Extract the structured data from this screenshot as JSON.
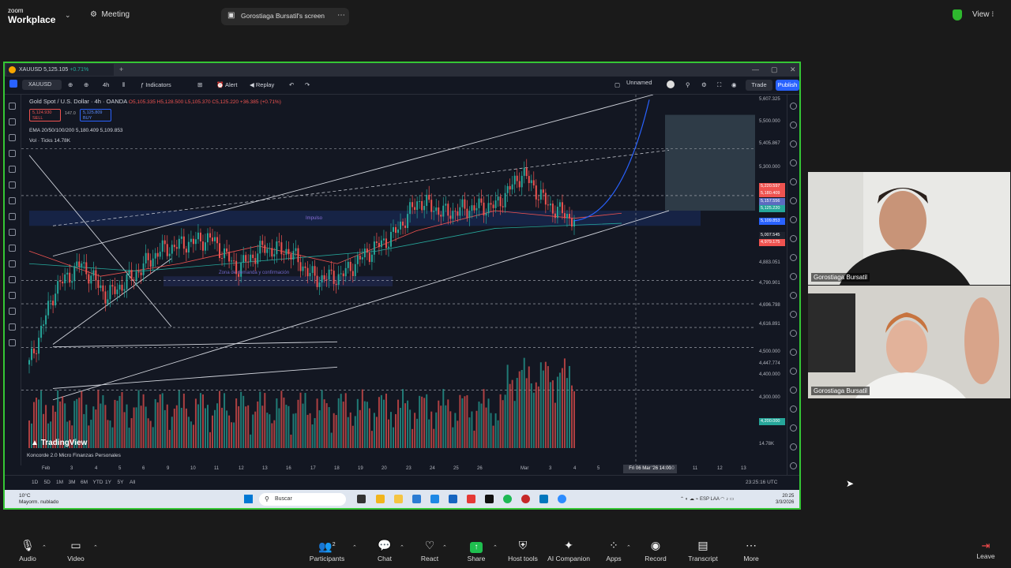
{
  "zoom_top": {
    "brand_small": "zoom",
    "brand": "Workplace",
    "meeting": "Meeting",
    "share_tab": "Gorostiaga Bursatil's screen",
    "view": "View"
  },
  "tradingview": {
    "tab_symbol": "XAUUSD",
    "tab_price": "5,125.105",
    "tab_change": "+0.71%",
    "symbol": "XAUUSD",
    "timeframe": "4h",
    "toolbar": {
      "indicators": "Indicators",
      "alert": "Alert",
      "replay": "Replay",
      "layout": "Unnamed",
      "trade": "Trade",
      "publish": "Publish"
    },
    "legend_title": "Gold Spot / U.S. Dollar · 4h · OANDA",
    "legend_ohlc": "O5,105.335 H5,128.500 L5,105.370 C5,125.220 +36.385 (+0.71%)",
    "sell_price": "5,124.930",
    "sell_label": "SELL",
    "spread": "147.0",
    "buy_price": "5,125.809",
    "buy_label": "BUY",
    "ema_legend": "EMA 20/50/100/200  5,180.409  5,109.853",
    "vol_legend": "Vol · Ticks  14.78K",
    "price_labels": [
      "5,607.325",
      "5,500.000",
      "5,405.867",
      "5,300.000",
      "5,220.597",
      "5,180.409",
      "5,157.556",
      "5,125.220",
      "5,109.853",
      "5,007.545",
      "4,979.175",
      "4,883.051",
      "4,790.901",
      "4,696.798",
      "4,616.891",
      "4,500.000",
      "4,447.774",
      "4,400.000",
      "4,300.000",
      "4,200.000",
      "14.78K"
    ],
    "time_labels": [
      "Feb",
      "3",
      "4",
      "5",
      "6",
      "9",
      "10",
      "11",
      "12",
      "13",
      "16",
      "17",
      "18",
      "19",
      "20",
      "23",
      "24",
      "25",
      "26",
      "Mar",
      "3",
      "4",
      "5",
      "10",
      "11",
      "12",
      "13"
    ],
    "crosshair_time": "Fri 06 Mar '26  14:00",
    "indicator_row": "Koncorde 2.0 Micro Finanzas Personales",
    "zone_label_1": "Impulso",
    "zone_label_2": "Zona de demanda y confirmación",
    "watermark": "TradingView",
    "timeframes": [
      "1D",
      "5D",
      "1M",
      "3M",
      "6M",
      "YTD",
      "1Y",
      "5Y",
      "All"
    ],
    "utc_time": "23:25:16 UTC"
  },
  "taskbar": {
    "weather_temp": "10°C",
    "weather_desc": "Mayorm. nublado",
    "search_placeholder": "Buscar",
    "lang": "ESP LAA",
    "time": "20:25",
    "date": "3/3/2026"
  },
  "participants": [
    {
      "name": "Gorostiaga Bursatil"
    },
    {
      "name": "Gorostiaga Bursatil"
    }
  ],
  "zoom_bottom": {
    "audio": "Audio",
    "video": "Video",
    "participants": "Participants",
    "participants_count": "2",
    "chat": "Chat",
    "react": "React",
    "share": "Share",
    "host_tools": "Host tools",
    "ai_companion": "AI Companion",
    "apps": "Apps",
    "record": "Record",
    "transcript": "Transcript",
    "more": "More",
    "leave": "Leave"
  },
  "colors": {
    "share_border": "#35c635",
    "bull": "#26a69a",
    "bear": "#ef5350",
    "accent": "#2962ff"
  },
  "chart_data": {
    "type": "candlestick",
    "symbol": "XAUUSD",
    "x": [
      "Feb",
      "3",
      "4",
      "5",
      "6",
      "9",
      "10",
      "11",
      "12",
      "13",
      "16",
      "17",
      "18",
      "19",
      "20",
      "23",
      "24",
      "25",
      "26",
      "Mar",
      "3",
      "4",
      "5",
      "10",
      "11",
      "12",
      "13"
    ],
    "close": [
      4550,
      4850,
      4950,
      4820,
      4900,
      5000,
      5030,
      5050,
      4930,
      5010,
      5000,
      4890,
      4900,
      4990,
      5060,
      5200,
      5150,
      5170,
      5180,
      5310,
      5180,
      5125
    ],
    "ylim": [
      4150,
      5620
    ],
    "volume_unit": "Ticks"
  }
}
